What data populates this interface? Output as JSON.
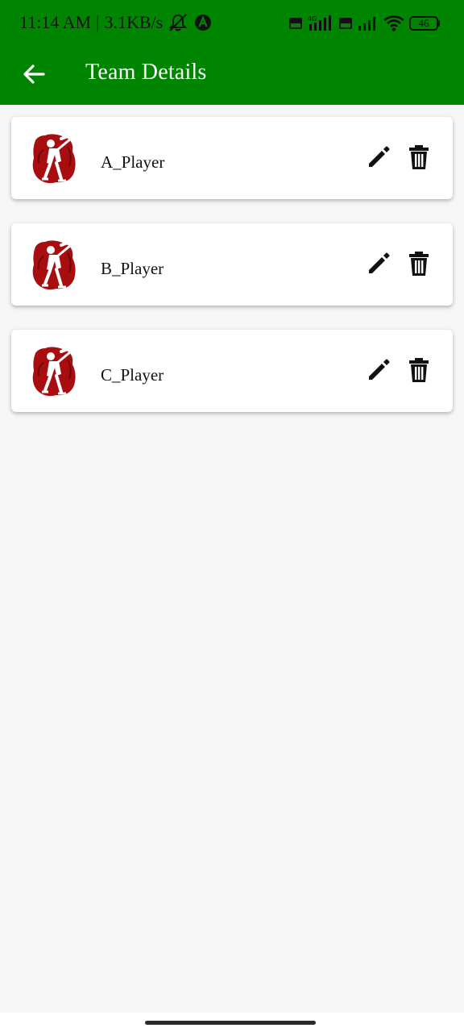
{
  "status_bar": {
    "time": "11:14 AM",
    "separator": "|",
    "network_speed": "3.1KB/s",
    "battery_level": "46",
    "icons": [
      "mute-icon",
      "a-circle-icon",
      "volte-icon",
      "4g-signal-icon",
      "volte-icon",
      "signal-icon",
      "wifi-icon",
      "battery-icon"
    ]
  },
  "app_bar": {
    "back_icon": "arrow-left-icon",
    "title": "Team Details"
  },
  "players": [
    {
      "name": "A_Player",
      "avatar_icon": "cricket-batsman-icon",
      "edit_icon": "pencil-icon",
      "delete_icon": "trash-icon"
    },
    {
      "name": "B_Player",
      "avatar_icon": "cricket-batsman-icon",
      "edit_icon": "pencil-icon",
      "delete_icon": "trash-icon"
    },
    {
      "name": "C_Player",
      "avatar_icon": "cricket-batsman-icon",
      "edit_icon": "pencil-icon",
      "delete_icon": "trash-icon"
    }
  ],
  "colors": {
    "header_green": "#008500",
    "background": "#f6f6f6",
    "card": "#ffffff",
    "avatar_red": "#a80d10"
  }
}
